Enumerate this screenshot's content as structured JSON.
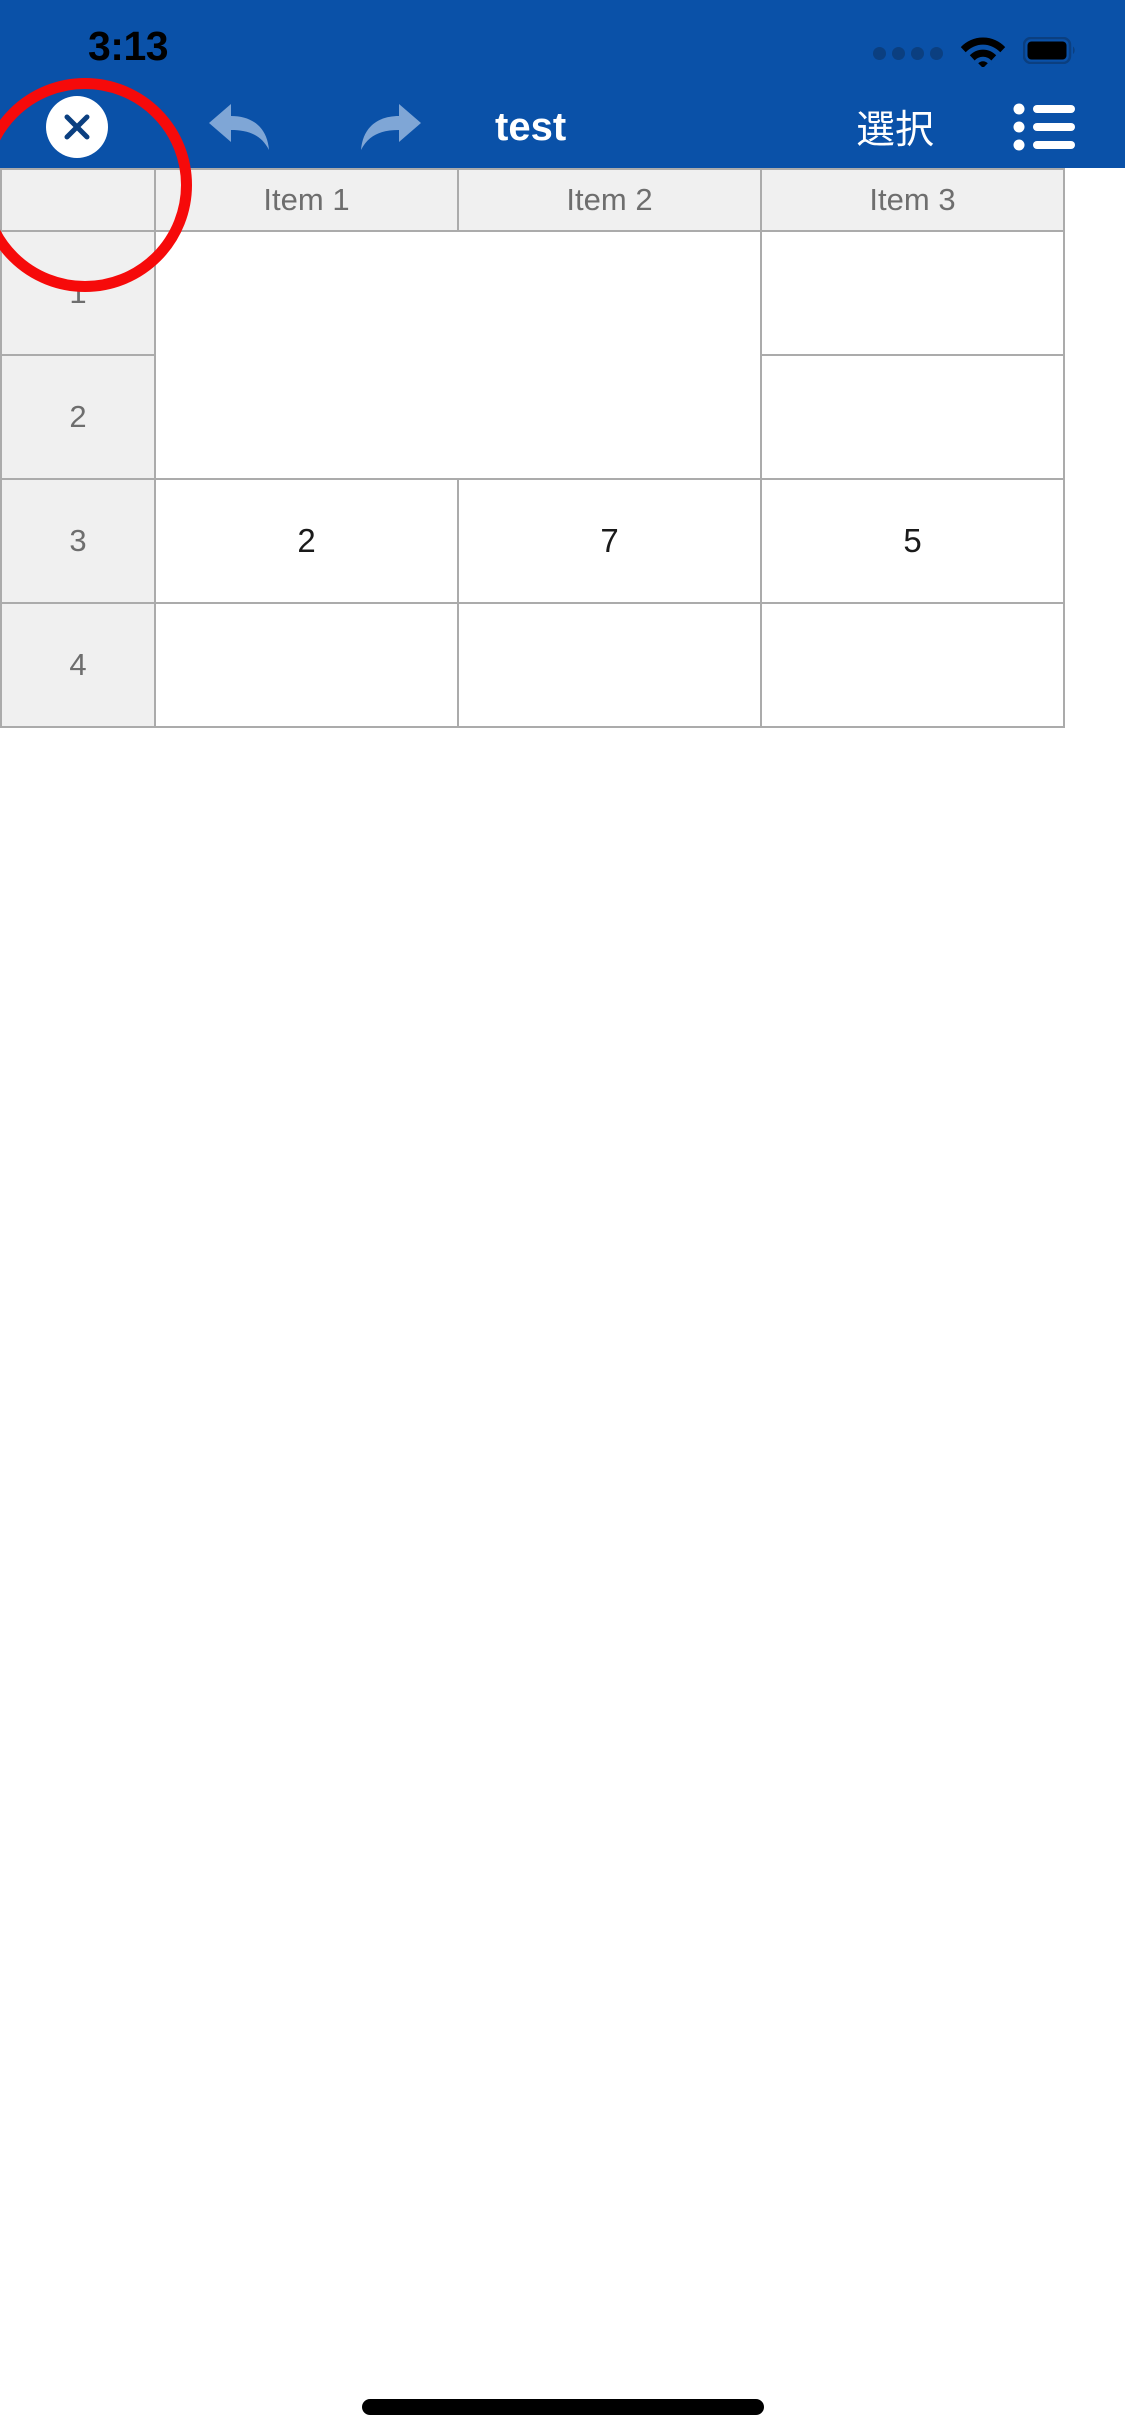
{
  "status_bar": {
    "time": "3:13",
    "signal_dots": 4,
    "wifi_icon": "wifi-icon",
    "battery_icon": "battery-full-icon",
    "background_color": "#0A51A8",
    "time_color": "#000000"
  },
  "toolbar": {
    "background_color": "#0A51A8",
    "close_label": "×",
    "close_icon": "close-x-icon",
    "undo_icon": "undo-arrow-icon",
    "redo_icon": "redo-arrow-icon",
    "undo_color": "#7FA6D6",
    "redo_color": "#7FA6D6",
    "title": "test",
    "select_label": "選択",
    "menu_icon": "list-menu-icon"
  },
  "annotation": {
    "shape": "circle",
    "color": "#F60A0A",
    "target": "close-button"
  },
  "spreadsheet": {
    "corner_label": "",
    "columns": [
      "Item 1",
      "Item 2",
      "Item 3"
    ],
    "row_labels": [
      "1",
      "2",
      "3",
      "4"
    ],
    "cells": {
      "merged_block": {
        "label": "",
        "rows": [
          "1",
          "2"
        ],
        "columns": [
          "Item 1",
          "Item 2"
        ],
        "value": ""
      },
      "row1": {
        "item3": ""
      },
      "row2": {
        "item3": ""
      },
      "row3": {
        "item1": "2",
        "item2": "7",
        "item3": "5"
      },
      "row4": {
        "item1": "",
        "item2": "",
        "item3": ""
      }
    },
    "header_bg": "#F0F0F0",
    "header_text_color": "#6E6E6E",
    "grid_color": "#ABABAB"
  },
  "home_indicator": {
    "color": "#000000"
  }
}
